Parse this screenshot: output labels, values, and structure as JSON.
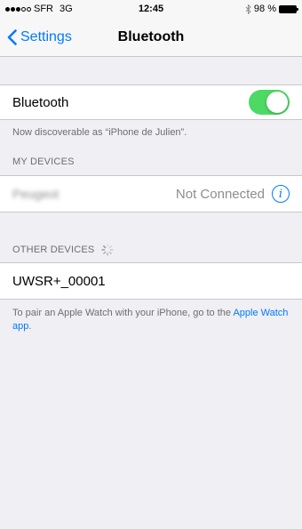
{
  "status_bar": {
    "carrier": "SFR",
    "network": "3G",
    "time": "12:45",
    "battery": "98 %",
    "battery_level": 0.98,
    "bluetooth_icon": "bluetooth-icon"
  },
  "nav": {
    "back_label": "Settings",
    "title": "Bluetooth"
  },
  "bluetooth": {
    "label": "Bluetooth",
    "enabled": true,
    "discoverable_note": "Now discoverable as “iPhone de Julien”."
  },
  "my_devices": {
    "header": "MY DEVICES",
    "items": [
      {
        "name": "Peugeot",
        "status": "Not Connected",
        "info_icon": "info-icon"
      }
    ]
  },
  "other_devices": {
    "header": "OTHER DEVICES",
    "items": [
      {
        "name": "UWSR+_00001"
      }
    ]
  },
  "footer": {
    "text": "To pair an Apple Watch with your iPhone, go to the ",
    "link": "Apple Watch app",
    "suffix": "."
  },
  "colors": {
    "accent": "#007aff",
    "toggle_on": "#4cd964",
    "background": "#efeff4"
  }
}
